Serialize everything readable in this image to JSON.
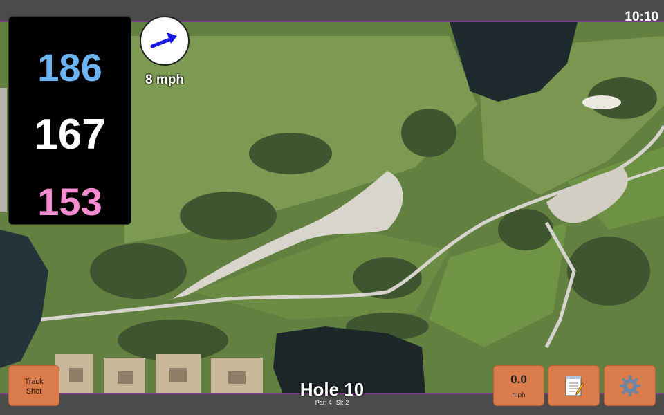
{
  "status": {
    "time": "10:10"
  },
  "distances": {
    "back": "186",
    "middle": "167",
    "front": "153",
    "colors": {
      "back": "#6db4f2",
      "middle": "#ffffff",
      "front": "#f48ccf"
    }
  },
  "wind": {
    "speed": "8 mph",
    "direction_icon": "arrow-icon",
    "arrow_color": "#1a1ae6"
  },
  "hole": {
    "title": "Hole 10",
    "par": "Par: 4",
    "si": "SI: 2"
  },
  "buttons": {
    "track_shot_line1": "Track",
    "track_shot_line2": "Shot",
    "wind_value": "0.0",
    "wind_unit": "mph",
    "notes_icon": "notepad-icon",
    "settings_icon": "gear-icon"
  },
  "colors": {
    "button": "#d97b4a",
    "map_border": "#7a3b86",
    "bars": "#4b4b4b"
  }
}
